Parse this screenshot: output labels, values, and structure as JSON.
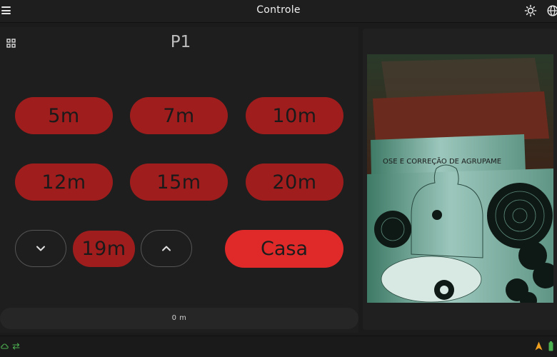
{
  "header": {
    "title": "Controle",
    "icons": [
      "menu-icon",
      "sun-icon",
      "globe-icon"
    ]
  },
  "panel": {
    "profile": "P1",
    "presets": [
      "5m",
      "7m",
      "10m",
      "12m",
      "15m",
      "20m"
    ],
    "current_distance": "19m",
    "home_label": "Casa",
    "status": "0 m"
  },
  "camera": {
    "target_banner": "OSE E CORREÇÃO DE AGRUPAME"
  },
  "footer": {
    "icons": [
      "cloud-icon",
      "sync-icon",
      "warning-icon",
      "battery-icon"
    ]
  },
  "colors": {
    "background": "#1b1b1b",
    "panel": "#1e1e1e",
    "preset_red": "#a01d1d",
    "accent_red": "#e02a2a",
    "status_green": "#4caf50",
    "warning_orange": "#f0a020"
  }
}
